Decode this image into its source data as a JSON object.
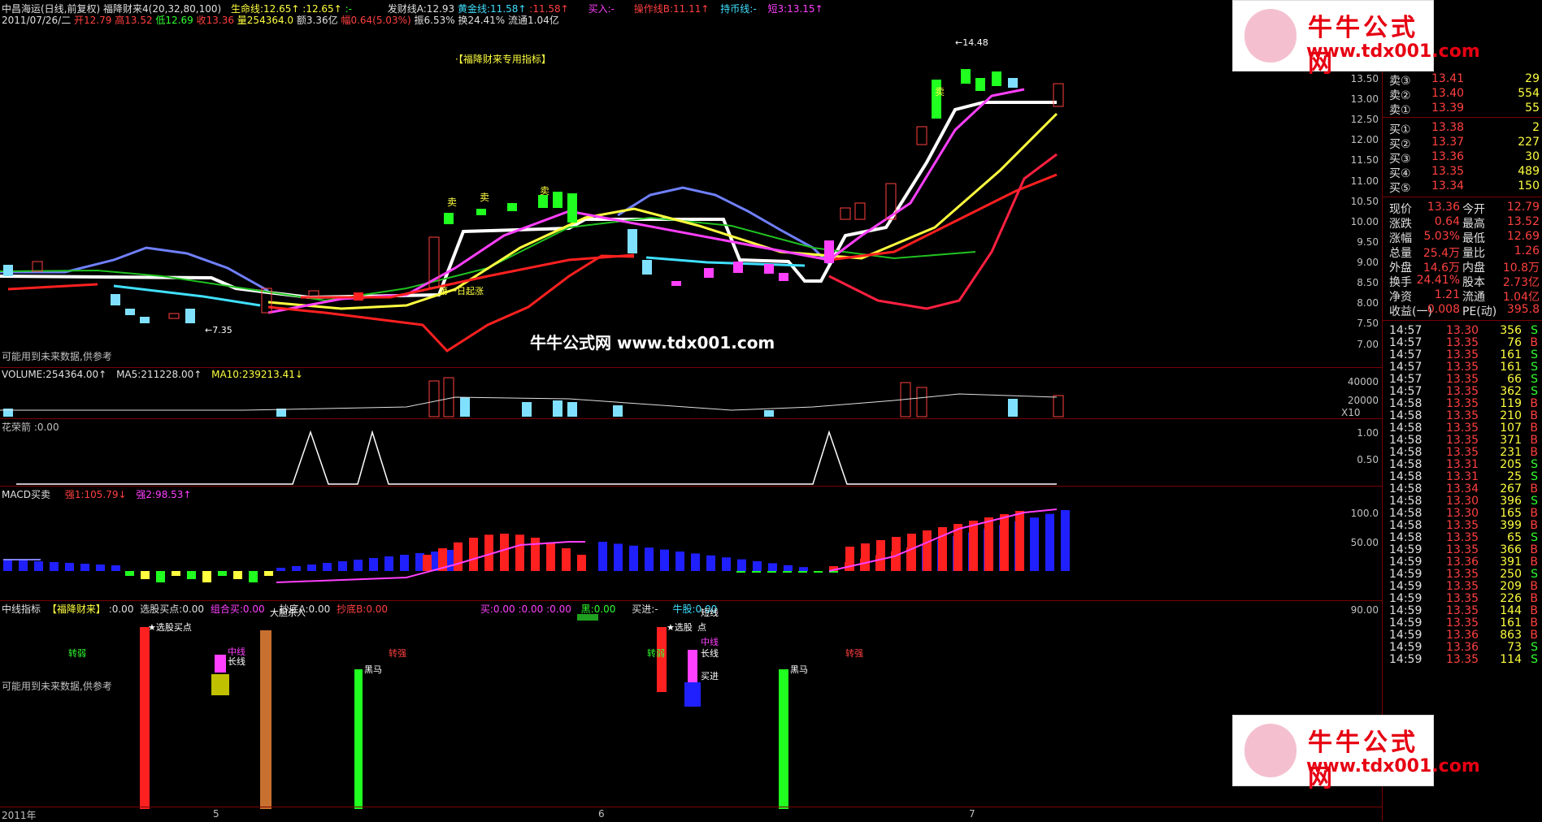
{
  "main_header": {
    "stock": "中昌海运(日线,前复权)",
    "indicator": "福降财来4(20,32,80,100)",
    "life_line": "生命线:12.65↑",
    "v2": ":12.65↑",
    "v3": ":-",
    "facai": "发财线A:12.93",
    "huangjin": "黄金线:11.58↑",
    "v4": ":11.58↑",
    "buy_in": "买入:-",
    "caozuo": "操作线B:11.11↑",
    "chibi": "持币线:-",
    "duan": "短3:13.15↑",
    "date": "2011/07/26/二",
    "open": "开12.79",
    "high": "高13.52",
    "low": "低12.69",
    "close": "收13.36",
    "vol": "量254364.0",
    "amt": "额3.36亿",
    "amp": "幅0.64(5.03%)",
    "zhen": "振6.53%",
    "huan": "换24.41%",
    "liutong": "流通1.04亿"
  },
  "main_center_label": "·【福降财来专用指标】",
  "watermark": "牛牛公式网 www.tdx001.com",
  "future_note": "可能用到未来数据,供参考",
  "price_labels": {
    "high": "14.48",
    "low": "7.35"
  },
  "annotations": {
    "mai1": "卖",
    "mai2": "卖",
    "mai3": "卖",
    "mai4": "卖",
    "rally": "第一日起涨"
  },
  "price_axis": [
    "13.50",
    "13.00",
    "12.50",
    "12.00",
    "11.50",
    "11.00",
    "10.50",
    "10.00",
    "9.50",
    "9.00",
    "8.50",
    "8.00",
    "7.50",
    "7.00"
  ],
  "volume_header": {
    "vol": "VOLUME:254364.00↑",
    "ma5": "MA5:211228.00↑",
    "ma10": "MA10:239213.41↓"
  },
  "volume_axis": [
    "40000",
    "20000",
    "X10"
  ],
  "hua_header": "花荣箭 :0.00",
  "hua_axis": [
    "1.00",
    "0.50"
  ],
  "macd_header": {
    "name": "MACD买卖",
    "q1": "强1:105.79↓",
    "q2": "强2:98.53↑"
  },
  "macd_axis": [
    "100.0",
    "50.00"
  ],
  "bottom_header": {
    "name": "中线指标",
    "tag": "【福降财来】",
    "v1": ":0.00",
    "xuangu": "选股买点:0.00",
    "zuhe": "组合买:0.00",
    "chaodiA": "抄底A:0.00",
    "chaodiB": "抄底B:0.00",
    "mai": "买:0.00",
    "mai2": ":0.00",
    "mai3": ":0.00",
    "hei": "黑:0.00",
    "maijin": "买进:-",
    "niugu": "牛股:0.00"
  },
  "bottom_axis": [
    "90.00"
  ],
  "bottom_labels": {
    "zhuanruo1": "转弱",
    "xuangu1": "★选股买点",
    "zhongxian1": "中线",
    "changxian1": "长线",
    "dadan": "大胆杀入",
    "heima1": "黑马",
    "zhuanqiang1": "转强",
    "zhuanruo2": "转弱",
    "xuangu2": "★选股",
    "dian": "点",
    "duanxian": "短线",
    "zhongxian2": "中线",
    "changxian2": "长线",
    "maijin": "买进",
    "heima2": "黑马",
    "zhuanqiang2": "转强"
  },
  "x_axis": [
    "2011年",
    "5",
    "6",
    "7"
  ],
  "quote": {
    "sell": [
      {
        "label": "卖③",
        "price": "13.41",
        "vol": "29"
      },
      {
        "label": "卖②",
        "price": "13.40",
        "vol": "554"
      },
      {
        "label": "卖①",
        "price": "13.39",
        "vol": "55"
      }
    ],
    "buy": [
      {
        "label": "买①",
        "price": "13.38",
        "vol": "2"
      },
      {
        "label": "买②",
        "price": "13.37",
        "vol": "227"
      },
      {
        "label": "买③",
        "price": "13.36",
        "vol": "30"
      },
      {
        "label": "买④",
        "price": "13.35",
        "vol": "489"
      },
      {
        "label": "买⑤",
        "price": "13.34",
        "vol": "150"
      }
    ],
    "stats": [
      {
        "l1": "现价",
        "v1": "13.36",
        "l2": "今开",
        "v2": "12.79"
      },
      {
        "l1": "涨跌",
        "v1": "0.64",
        "l2": "最高",
        "v2": "13.52"
      },
      {
        "l1": "涨幅",
        "v1": "5.03%",
        "l2": "最低",
        "v2": "12.69"
      },
      {
        "l1": "总量",
        "v1": "25.4万",
        "l2": "量比",
        "v2": "1.26"
      },
      {
        "l1": "外盘",
        "v1": "14.6万",
        "l2": "内盘",
        "v2": "10.8万"
      },
      {
        "l1": "换手",
        "v1": "24.41%",
        "l2": "股本",
        "v2": "2.73亿"
      },
      {
        "l1": "净资",
        "v1": "1.21",
        "l2": "流通",
        "v2": "1.04亿"
      },
      {
        "l1": "收益(一)",
        "v1": "0.008",
        "l2": "PE(动)",
        "v2": "395.8"
      }
    ],
    "ticks": [
      {
        "t": "14:57",
        "p": "13.30",
        "v": "356",
        "s": "S"
      },
      {
        "t": "14:57",
        "p": "13.35",
        "v": "76",
        "s": "B"
      },
      {
        "t": "14:57",
        "p": "13.35",
        "v": "161",
        "s": "S"
      },
      {
        "t": "14:57",
        "p": "13.35",
        "v": "161",
        "s": "S"
      },
      {
        "t": "14:57",
        "p": "13.35",
        "v": "66",
        "s": "S"
      },
      {
        "t": "14:57",
        "p": "13.35",
        "v": "362",
        "s": "S"
      },
      {
        "t": "14:58",
        "p": "13.35",
        "v": "119",
        "s": "B"
      },
      {
        "t": "14:58",
        "p": "13.35",
        "v": "210",
        "s": "B"
      },
      {
        "t": "14:58",
        "p": "13.35",
        "v": "107",
        "s": "B"
      },
      {
        "t": "14:58",
        "p": "13.35",
        "v": "371",
        "s": "B"
      },
      {
        "t": "14:58",
        "p": "13.35",
        "v": "231",
        "s": "B"
      },
      {
        "t": "14:58",
        "p": "13.31",
        "v": "205",
        "s": "S"
      },
      {
        "t": "14:58",
        "p": "13.31",
        "v": "25",
        "s": "S"
      },
      {
        "t": "14:58",
        "p": "13.34",
        "v": "267",
        "s": "B"
      },
      {
        "t": "14:58",
        "p": "13.30",
        "v": "396",
        "s": "S"
      },
      {
        "t": "14:58",
        "p": "13.30",
        "v": "165",
        "s": "B"
      },
      {
        "t": "14:58",
        "p": "13.35",
        "v": "399",
        "s": "B"
      },
      {
        "t": "14:58",
        "p": "13.35",
        "v": "65",
        "s": "S"
      },
      {
        "t": "14:59",
        "p": "13.35",
        "v": "366",
        "s": "B"
      },
      {
        "t": "14:59",
        "p": "13.36",
        "v": "391",
        "s": "B"
      },
      {
        "t": "14:59",
        "p": "13.35",
        "v": "250",
        "s": "S"
      },
      {
        "t": "14:59",
        "p": "13.35",
        "v": "209",
        "s": "B"
      },
      {
        "t": "14:59",
        "p": "13.35",
        "v": "226",
        "s": "B"
      },
      {
        "t": "14:59",
        "p": "13.35",
        "v": "144",
        "s": "B"
      },
      {
        "t": "14:59",
        "p": "13.35",
        "v": "161",
        "s": "B"
      },
      {
        "t": "14:59",
        "p": "13.36",
        "v": "863",
        "s": "B"
      },
      {
        "t": "14:59",
        "p": "13.36",
        "v": "73",
        "s": "S"
      },
      {
        "t": "14:59",
        "p": "13.35",
        "v": "114",
        "s": "S"
      }
    ]
  },
  "logo": {
    "title": "牛牛公式网",
    "url": "www.tdx001.com"
  },
  "colors": {
    "up": "#ff4040",
    "down": "#40ffff",
    "bg": "#000000",
    "grid": "#7a0000"
  }
}
